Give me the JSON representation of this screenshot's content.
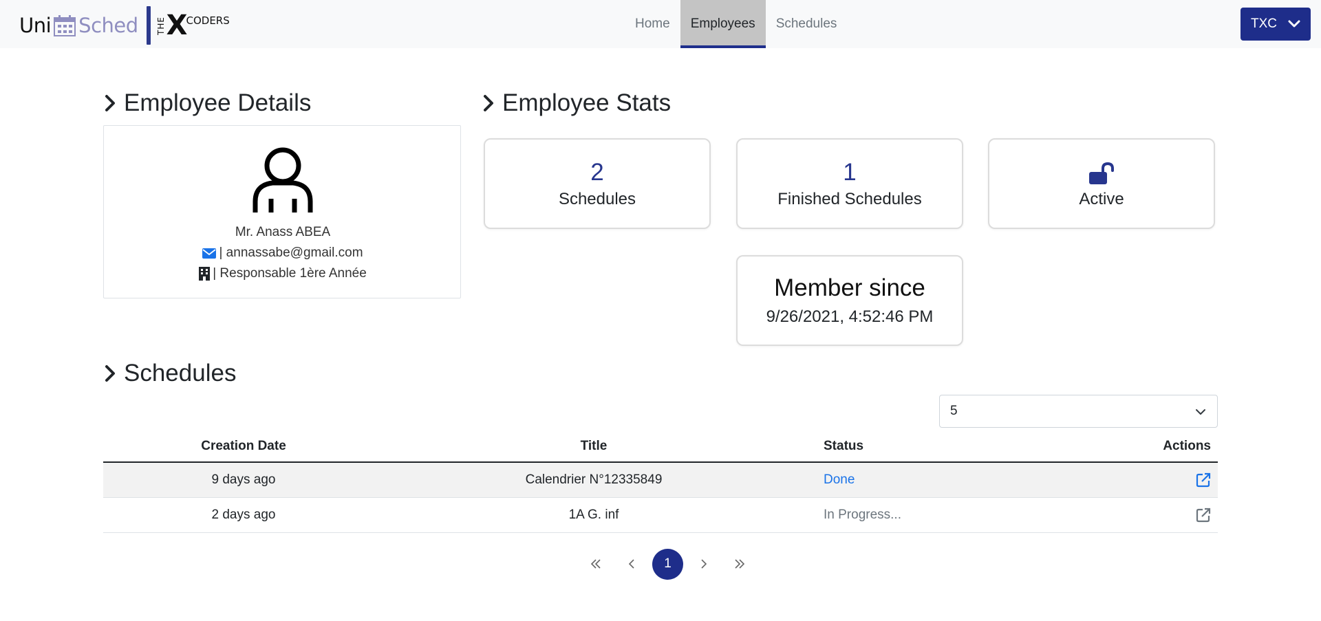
{
  "brand": {
    "uni": "Uni",
    "sched": "Sched",
    "the": "THE",
    "x": "X",
    "coders": "CODERS"
  },
  "nav": {
    "links": [
      {
        "label": "Home",
        "active": false
      },
      {
        "label": "Employees",
        "active": true
      },
      {
        "label": "Schedules",
        "active": false
      }
    ],
    "user_button": "TXC"
  },
  "employee_details": {
    "heading": "Employee Details",
    "name": "Mr. Anass ABEA",
    "email": "| annassabe@gmail.com",
    "role": "| Responsable 1ère Année"
  },
  "employee_stats": {
    "heading": "Employee Stats",
    "schedules_count": "2",
    "schedules_label": "Schedules",
    "finished_count": "1",
    "finished_label": "Finished Schedules",
    "status_label": "Active",
    "member_since_title": "Member since",
    "member_since_date": "9/26/2021, 4:52:46 PM"
  },
  "schedules": {
    "heading": "Schedules",
    "page_size": "5",
    "columns": [
      "Creation Date",
      "Title",
      "Status",
      "Actions"
    ],
    "rows": [
      {
        "created": "9 days ago",
        "title": "Calendrier N°12335849",
        "status": "Done"
      },
      {
        "created": "2 days ago",
        "title": "1A G. inf",
        "status": "In Progress..."
      }
    ],
    "pagination": {
      "current_page": "1"
    }
  },
  "colors": {
    "primary": "#1e2d8a",
    "link": "#1a73e8",
    "muted": "#6c757d",
    "navbar_bg": "#f8f9fa"
  },
  "icons": [
    "calendar-logo-icon",
    "chevron-right-icon",
    "user-icon",
    "envelope-icon",
    "building-icon",
    "lock-open-icon",
    "chevron-down-icon",
    "external-link-icon",
    "double-chevron-left-icon",
    "chevron-left-icon",
    "chevron-right-icon",
    "double-chevron-right-icon"
  ]
}
